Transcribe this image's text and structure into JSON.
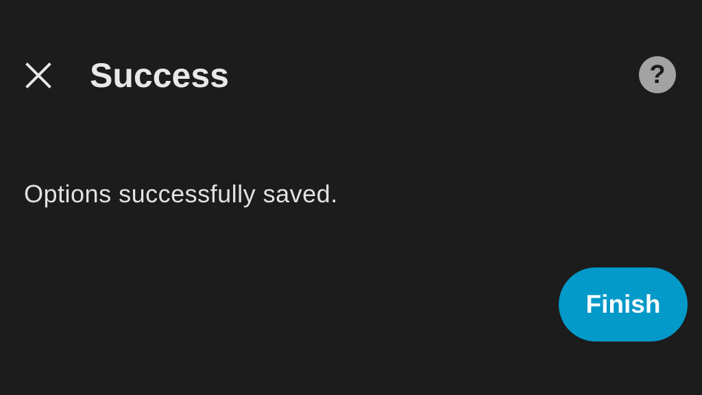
{
  "dialog": {
    "title": "Success",
    "message": "Options successfully saved.",
    "finish_label": "Finish",
    "help_glyph": "?",
    "close_icon": "close-icon",
    "help_icon": "help-icon"
  },
  "colors": {
    "background": "#1c1c1c",
    "text": "#e6e6e6",
    "accent": "#0399c9",
    "help_circle": "#a3a3a3"
  }
}
